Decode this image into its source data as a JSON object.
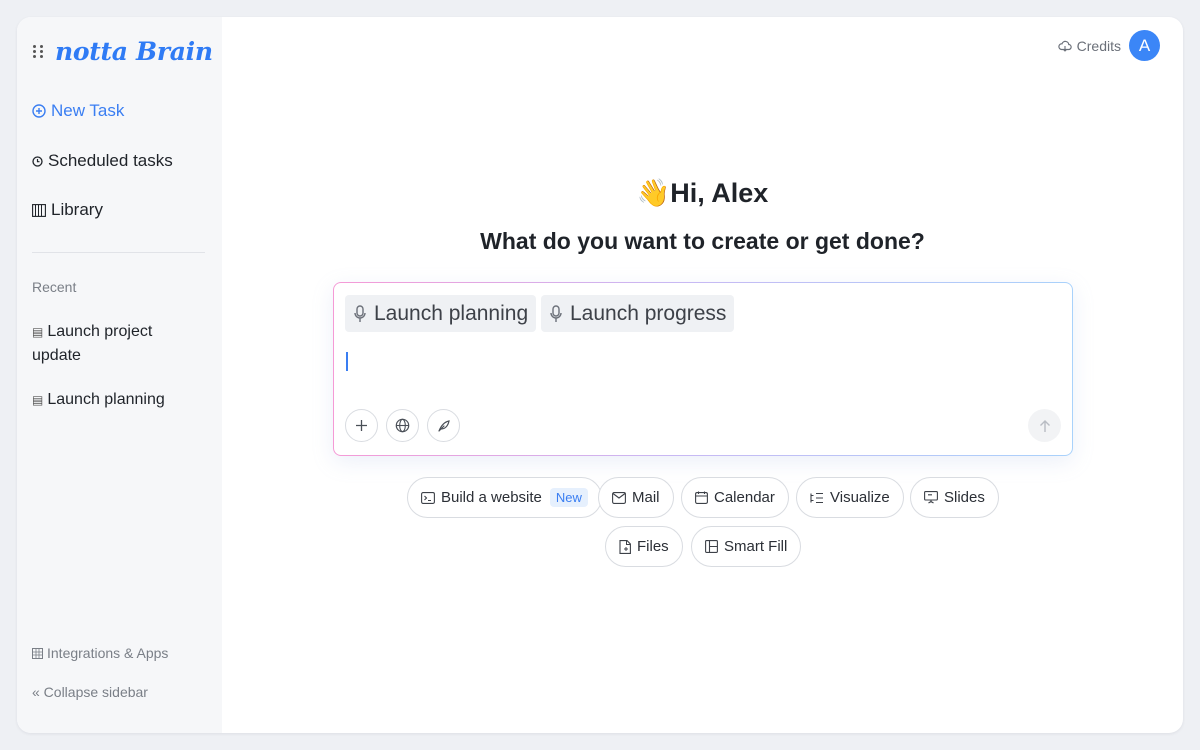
{
  "sidebar": {
    "logo": "notta Brain",
    "nav": {
      "new_task": "New Task",
      "scheduled": "Scheduled tasks",
      "library": "Library"
    },
    "recent_label": "Recent",
    "recent": [
      {
        "label": "Launch project update"
      },
      {
        "label": "Launch planning"
      }
    ],
    "integrations": "Integrations & Apps",
    "collapse": "« Collapse sidebar"
  },
  "header": {
    "credits": "Credits",
    "avatar_initial": "A"
  },
  "main": {
    "wave_emoji": "👋",
    "greeting": "Hi, Alex",
    "subtitle": "What do you want to create or get done?"
  },
  "composer": {
    "chips": [
      {
        "label": "Launch planning",
        "icon": "microphone-icon"
      },
      {
        "label": "Launch progress",
        "icon": "microphone-icon"
      }
    ],
    "input_value": ""
  },
  "quick_actions": [
    {
      "label": "Build a website",
      "badge": "New",
      "icon": "terminal-icon"
    },
    {
      "label": "Mail",
      "icon": "mail-icon"
    },
    {
      "label": "Calendar",
      "icon": "calendar-icon"
    },
    {
      "label": "Visualize",
      "icon": "list-tree-icon"
    },
    {
      "label": "Slides",
      "icon": "presentation-icon"
    },
    {
      "label": "Files",
      "icon": "file-icon"
    },
    {
      "label": "Smart Fill",
      "icon": "table-icon"
    }
  ],
  "colors": {
    "accent": "#3a7ef2",
    "logo": "#2f7bf5",
    "avatar": "#3b86f7"
  }
}
